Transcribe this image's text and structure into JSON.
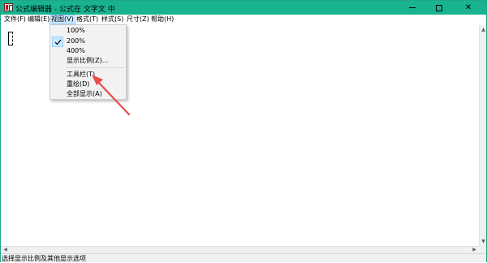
{
  "window": {
    "title": "公式编辑器 - 公式在 文字文 中",
    "controls": {
      "minimize": "–",
      "maximize": "□",
      "close": "✕"
    }
  },
  "menubar": {
    "items": [
      {
        "label": "文件(F)"
      },
      {
        "label": "编辑(E)"
      },
      {
        "label": "视图(V)",
        "active": true
      },
      {
        "label": "格式(T)"
      },
      {
        "label": "样式(S)"
      },
      {
        "label": "尺寸(Z)"
      },
      {
        "label": "帮助(H)"
      }
    ]
  },
  "view_menu": {
    "items": [
      {
        "label": "100%"
      },
      {
        "label": "200%",
        "checked": true
      },
      {
        "label": "400%"
      },
      {
        "label": "显示比例(Z)..."
      },
      {
        "label": "工具栏(T)"
      },
      {
        "label": "重绘(D)"
      },
      {
        "label": "全部显示(A)"
      }
    ]
  },
  "scrollbars": {
    "up": "▲",
    "down": "▼",
    "left": "◀",
    "right": "▶"
  },
  "status": {
    "text": "选择显示比例及其他显示选项"
  },
  "colors": {
    "titlebar": "#19b38f",
    "highlight": "#cce8ff",
    "annotation_arrow": "#e84c4c"
  }
}
